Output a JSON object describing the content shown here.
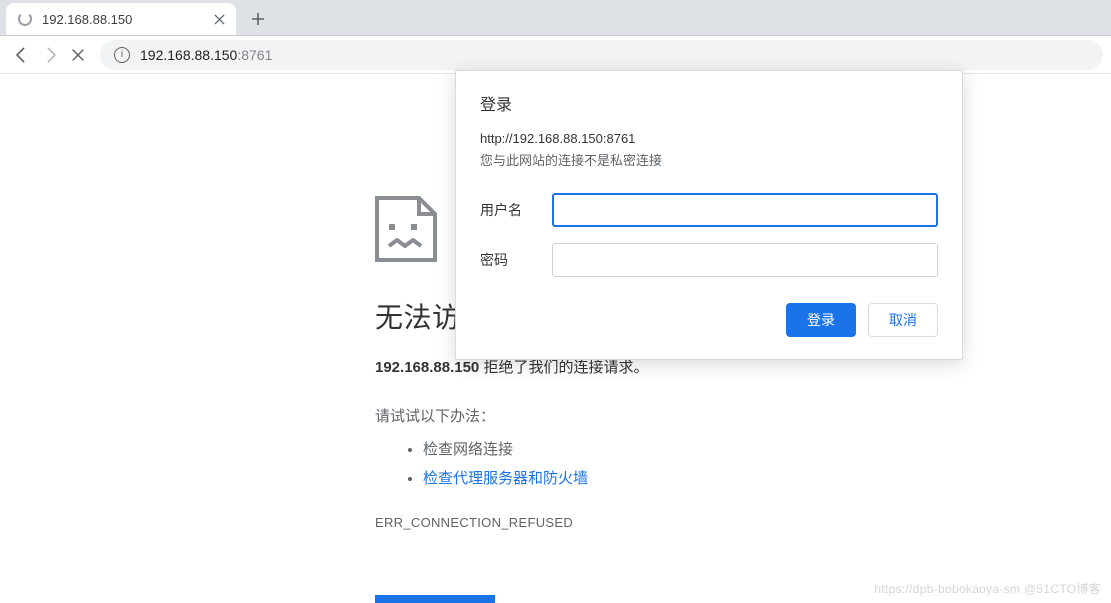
{
  "tab": {
    "title": "192.168.88.150"
  },
  "address": {
    "host": "192.168.88.150",
    "port": ":8761"
  },
  "error": {
    "heading": "无法访问",
    "sub_bold": "192.168.88.150",
    "sub_rest": " 拒绝了我们的连接请求。",
    "try_label": "请试试以下办法：",
    "tips": {
      "0": "检查网络连接",
      "1": "检查代理服务器和防火墙"
    },
    "code": "ERR_CONNECTION_REFUSED"
  },
  "dialog": {
    "title": "登录",
    "url": "http://192.168.88.150:8761",
    "warn": "您与此网站的连接不是私密连接",
    "username_label": "用户名",
    "password_label": "密码",
    "username_value": "",
    "password_value": "",
    "login_btn": "登录",
    "cancel_btn": "取消"
  },
  "watermark": "https://dpb-bobokaoya-sm @51CTO博客"
}
